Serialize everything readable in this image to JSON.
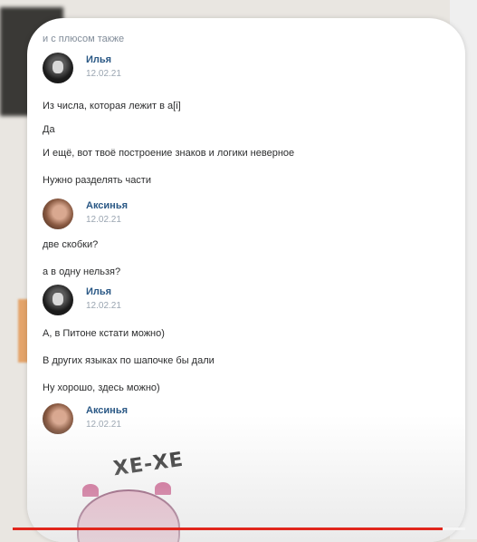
{
  "top_line": "и с плюсом также",
  "messages": [
    {
      "name": "Илья",
      "time": "12.02.21",
      "avatar": "dark-mask-avatar"
    },
    {
      "name": "Аксинья",
      "time": "12.02.21",
      "avatar": "woman-avatar"
    },
    {
      "name": "Илья",
      "time": "12.02.21",
      "avatar": "dark-mask-avatar"
    },
    {
      "name": "Аксинья",
      "time": "12.02.21",
      "avatar": "woman-avatar"
    }
  ],
  "lines": [
    "Из числа, которая лежит в a[i]",
    "Да",
    "И ещё, вот твоё построение знаков и логики неверное",
    "Нужно разделять части",
    "две скобки?",
    "а в одну нельзя?",
    "А, в Питоне кстати можно)",
    "В других языках по шапочке бы дали",
    "Ну хорошо, здесь можно)"
  ],
  "sticker_text": "ХЕ-ХЕ",
  "video_progress": 0.95,
  "colors": {
    "link": "#2a5885",
    "progress": "#e1261c"
  }
}
